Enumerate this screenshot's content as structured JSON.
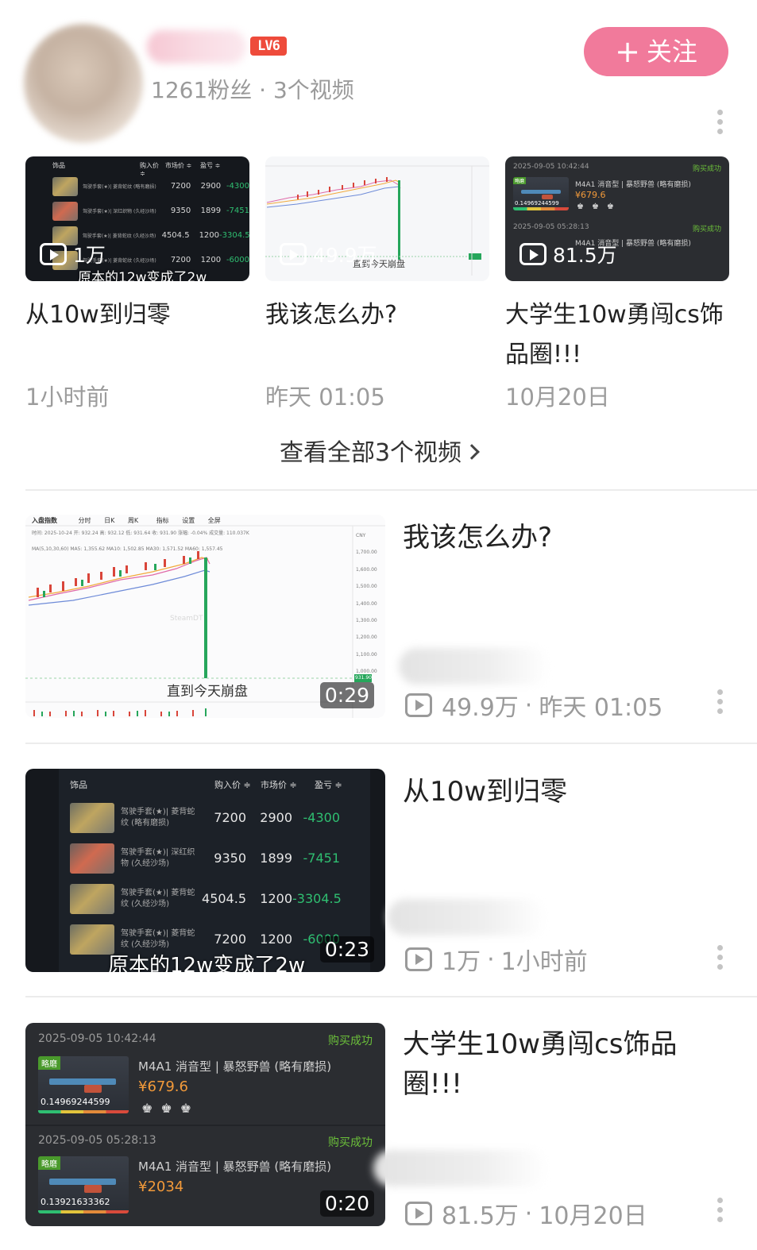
{
  "header": {
    "level_badge": "LV6",
    "fans_text": "1261粉丝 · 3个视频",
    "follow_button": "关注"
  },
  "carousel": [
    {
      "views": "1万",
      "title": "从10w到归零",
      "time": "1小时前"
    },
    {
      "views": "49.9万",
      "title": "我该怎么办?",
      "time": "昨天 01:05"
    },
    {
      "views": "81.5万",
      "title": "大学生10w勇闯cs饰品圈!!!",
      "time": "10月20日"
    }
  ],
  "view_all": "查看全部3个视频",
  "list": [
    {
      "title": "我该怎么办?",
      "duration": "0:29",
      "views": "49.9万",
      "time": "昨天 01:05"
    },
    {
      "title": "从10w到归零",
      "duration": "0:23",
      "views": "1万",
      "time": "1小时前"
    },
    {
      "title": "大学生10w勇闯cs饰品圈!!!",
      "duration": "0:20",
      "views": "81.5万",
      "time": "10月20日"
    }
  ],
  "thumb_table": {
    "headers": [
      "饰品",
      "购入价 ≑",
      "市场价 ≑",
      "盈亏 ≑"
    ],
    "rows": [
      {
        "item": "驾驶手套(★)| 菱背蛇纹 (略有磨损)",
        "buy": "7200",
        "market": "2900",
        "pnl": "-4300"
      },
      {
        "item": "驾驶手套(★)| 深红织物 (久经沙场)",
        "buy": "9350",
        "market": "1899",
        "pnl": "-7451"
      },
      {
        "item": "驾驶手套(★)| 菱背蛇纹 (久经沙场)",
        "buy": "4504.5",
        "market": "1200",
        "pnl": "-3304.5"
      },
      {
        "item": "驾驶手套(★)| 菱背蛇纹 (久经沙场)",
        "buy": "7200",
        "market": "1200",
        "pnl": "-6000"
      }
    ],
    "subtitle": "原本的12w变成了2w"
  },
  "thumb_chart": {
    "toolbar": [
      "入盘指数",
      "分时",
      "日K",
      "周K",
      "指标",
      "设置",
      "全屏"
    ],
    "info": "时间: 2025-10-24  开: 932.24  高: 932.12  低: 931.64  收: 931.90  涨幅: -0.04%  成交量: 110.037K",
    "ma": "MA(5,10,30,60)  MA5: 1,355.62  MA10: 1,502.85  MA30: 1,571.52  MA60: 1,557.45",
    "yticks": [
      "CNY",
      "1,700.00",
      "1,600.00",
      "1,500.00",
      "1,400.00",
      "1,300.00",
      "1,200.00",
      "1,100.00",
      "1,000.00"
    ],
    "last_price": "931.90",
    "subtitle": "直到今天崩盘",
    "watermark": "SteamDT"
  },
  "thumb_orders": {
    "orders": [
      {
        "date": "2025-09-05 10:42:44",
        "status": "购买成功",
        "tag": "略磨",
        "name": "M4A1 消音型 | 暴怒野兽 (略有磨损)",
        "price": "¥679.6",
        "float": "0.14969244599"
      },
      {
        "date": "2025-09-05 05:28:13",
        "status": "购买成功",
        "tag": "略磨",
        "name": "M4A1 消音型 | 暴怒野兽 (略有磨损)",
        "price": "¥2034",
        "float": "0.13921633362"
      }
    ]
  },
  "colors": {
    "accent": "#f17a9b",
    "badge": "#ee4b3b",
    "loss": "#2fbf71",
    "price": "#f29a3a"
  }
}
